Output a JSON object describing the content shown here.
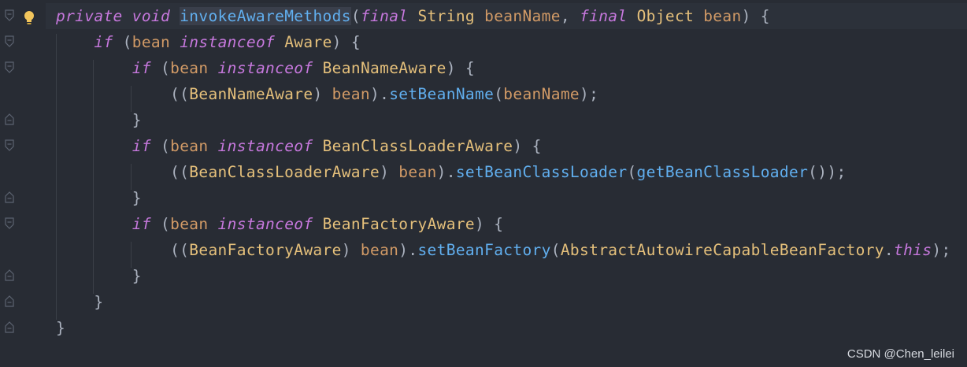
{
  "editor": {
    "lines": [
      [
        {
          "t": "private",
          "c": "kw"
        },
        {
          "t": " ",
          "c": "pl"
        },
        {
          "t": "void",
          "c": "kw"
        },
        {
          "t": " ",
          "c": "pl"
        },
        {
          "t": "invokeAwareMethods",
          "c": "fn hl"
        },
        {
          "t": "(",
          "c": "pl"
        },
        {
          "t": "final",
          "c": "kw"
        },
        {
          "t": " ",
          "c": "pl"
        },
        {
          "t": "String",
          "c": "tp"
        },
        {
          "t": " ",
          "c": "pl"
        },
        {
          "t": "beanName",
          "c": "id"
        },
        {
          "t": ", ",
          "c": "pl"
        },
        {
          "t": "final",
          "c": "kw"
        },
        {
          "t": " ",
          "c": "pl"
        },
        {
          "t": "Object",
          "c": "tp"
        },
        {
          "t": " ",
          "c": "pl"
        },
        {
          "t": "bean",
          "c": "id"
        },
        {
          "t": ") {",
          "c": "pl"
        }
      ],
      [
        {
          "t": "    ",
          "c": "pl"
        },
        {
          "t": "if",
          "c": "kw"
        },
        {
          "t": " (",
          "c": "pl"
        },
        {
          "t": "bean",
          "c": "id"
        },
        {
          "t": " ",
          "c": "pl"
        },
        {
          "t": "instanceof",
          "c": "kw"
        },
        {
          "t": " ",
          "c": "pl"
        },
        {
          "t": "Aware",
          "c": "tp"
        },
        {
          "t": ") {",
          "c": "pl"
        }
      ],
      [
        {
          "t": "        ",
          "c": "pl"
        },
        {
          "t": "if",
          "c": "kw"
        },
        {
          "t": " (",
          "c": "pl"
        },
        {
          "t": "bean",
          "c": "id"
        },
        {
          "t": " ",
          "c": "pl"
        },
        {
          "t": "instanceof",
          "c": "kw"
        },
        {
          "t": " ",
          "c": "pl"
        },
        {
          "t": "BeanNameAware",
          "c": "tp"
        },
        {
          "t": ") {",
          "c": "pl"
        }
      ],
      [
        {
          "t": "            ((",
          "c": "pl"
        },
        {
          "t": "BeanNameAware",
          "c": "tp"
        },
        {
          "t": ") ",
          "c": "pl"
        },
        {
          "t": "bean",
          "c": "id"
        },
        {
          "t": ").",
          "c": "pl"
        },
        {
          "t": "setBeanName",
          "c": "fn"
        },
        {
          "t": "(",
          "c": "pl"
        },
        {
          "t": "beanName",
          "c": "id"
        },
        {
          "t": ");",
          "c": "pl"
        }
      ],
      [
        {
          "t": "        }",
          "c": "pl"
        }
      ],
      [
        {
          "t": "        ",
          "c": "pl"
        },
        {
          "t": "if",
          "c": "kw"
        },
        {
          "t": " (",
          "c": "pl"
        },
        {
          "t": "bean",
          "c": "id"
        },
        {
          "t": " ",
          "c": "pl"
        },
        {
          "t": "instanceof",
          "c": "kw"
        },
        {
          "t": " ",
          "c": "pl"
        },
        {
          "t": "BeanClassLoaderAware",
          "c": "tp"
        },
        {
          "t": ") {",
          "c": "pl"
        }
      ],
      [
        {
          "t": "            ((",
          "c": "pl"
        },
        {
          "t": "BeanClassLoaderAware",
          "c": "tp"
        },
        {
          "t": ") ",
          "c": "pl"
        },
        {
          "t": "bean",
          "c": "id"
        },
        {
          "t": ").",
          "c": "pl"
        },
        {
          "t": "setBeanClassLoader",
          "c": "fn"
        },
        {
          "t": "(",
          "c": "pl"
        },
        {
          "t": "getBeanClassLoader",
          "c": "fn"
        },
        {
          "t": "());",
          "c": "pl"
        }
      ],
      [
        {
          "t": "        }",
          "c": "pl"
        }
      ],
      [
        {
          "t": "        ",
          "c": "pl"
        },
        {
          "t": "if",
          "c": "kw"
        },
        {
          "t": " (",
          "c": "pl"
        },
        {
          "t": "bean",
          "c": "id"
        },
        {
          "t": " ",
          "c": "pl"
        },
        {
          "t": "instanceof",
          "c": "kw"
        },
        {
          "t": " ",
          "c": "pl"
        },
        {
          "t": "BeanFactoryAware",
          "c": "tp"
        },
        {
          "t": ") {",
          "c": "pl"
        }
      ],
      [
        {
          "t": "            ((",
          "c": "pl"
        },
        {
          "t": "BeanFactoryAware",
          "c": "tp"
        },
        {
          "t": ") ",
          "c": "pl"
        },
        {
          "t": "bean",
          "c": "id"
        },
        {
          "t": ").",
          "c": "pl"
        },
        {
          "t": "setBeanFactory",
          "c": "fn"
        },
        {
          "t": "(",
          "c": "pl"
        },
        {
          "t": "AbstractAutowireCapableBeanFactory",
          "c": "tp"
        },
        {
          "t": ".",
          "c": "pl"
        },
        {
          "t": "this",
          "c": "kw"
        },
        {
          "t": ");",
          "c": "pl"
        }
      ],
      [
        {
          "t": "        }",
          "c": "pl"
        }
      ],
      [
        {
          "t": "    }",
          "c": "pl"
        }
      ],
      [
        {
          "t": "}",
          "c": "pl"
        }
      ]
    ]
  },
  "gutter": {
    "icons": [
      "fold-open-icon",
      "fold-open-icon",
      "fold-open-icon",
      "",
      "fold-close-icon",
      "fold-open-icon",
      "",
      "fold-close-icon",
      "fold-open-icon",
      "",
      "fold-close-icon",
      "fold-close-icon",
      "fold-close-icon"
    ],
    "bulb_icon": "lightbulb-icon"
  },
  "watermark": "CSDN @Chen_leilei",
  "colors": {
    "background": "#282c34",
    "keyword": "#c678dd",
    "type": "#e5c07b",
    "identifier": "#d19a66",
    "function": "#61afef",
    "plain": "#abb2bf"
  }
}
